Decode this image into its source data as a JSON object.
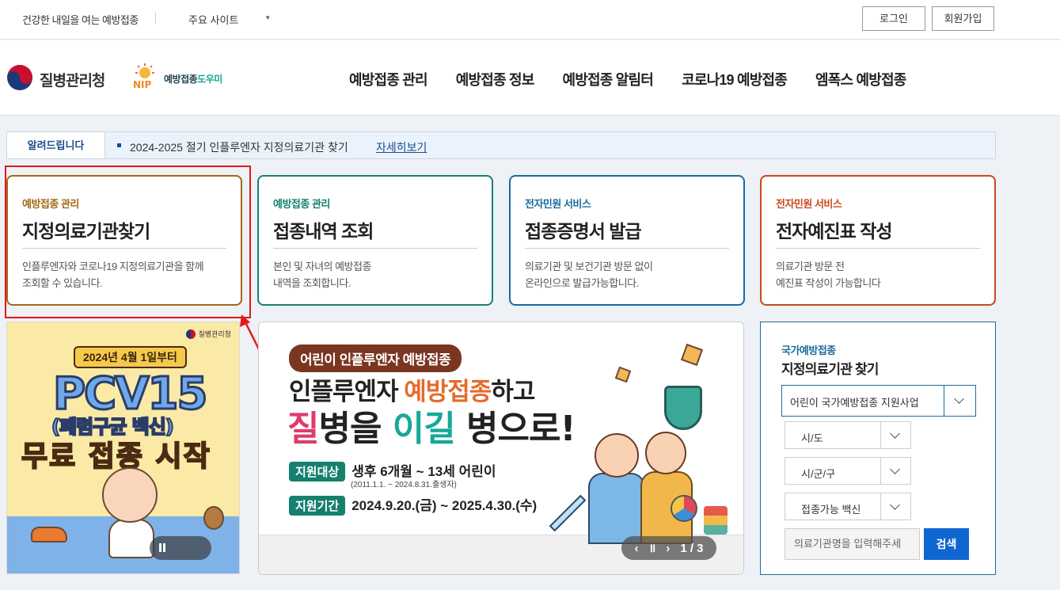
{
  "topbar": {
    "slogan": "건강한 내일을 여는 예방접종",
    "sites": "주요 사이트",
    "sites_caret": "▾",
    "login": "로그인",
    "join": "회원가입"
  },
  "header": {
    "kdca_name": "질병관리청",
    "nip_prefix": "예방접종",
    "nip_suffix": "도우미",
    "nip_badge": "NIP",
    "nav": [
      "예방접종 관리",
      "예방접종 정보",
      "예방접종 알림터",
      "코로나19 예방접종",
      "엠폭스 예방접종"
    ]
  },
  "notice": {
    "label": "알려드립니다",
    "text": "2024-2025 절기 인플루엔자 지정의료기관 찾기",
    "more": "자세히보기"
  },
  "cards": [
    {
      "category": "예방접종 관리",
      "title": "지정의료기관찾기",
      "desc1": "인플루엔자와 코로나19 지정의료기관을 함께",
      "desc2": "조회할 수 있습니다."
    },
    {
      "category": "예방접종 관리",
      "title": "접종내역 조회",
      "desc1": "본인 및 자녀의 예방접종",
      "desc2": "내역을 조회합니다."
    },
    {
      "category": "전자민원 서비스",
      "title": "접종증명서 발급",
      "desc1": "의료기관 및 보건기관 방문 없이",
      "desc2": "온라인으로 발급가능합니다."
    },
    {
      "category": "전자민원 서비스",
      "title": "전자예진표 작성",
      "desc1": "의료기관 방문 전",
      "desc2": "예진표 작성이 가능합니다"
    }
  ],
  "poster": {
    "logo": "질병관리청",
    "date": "2024년 4월 1일부터",
    "pcv": "PCV15",
    "sub": "(폐렴구균 백신)",
    "free": "무료 접종 시작"
  },
  "banner": {
    "tag": "어린이 인플루엔자 예방접종",
    "line1_a": "인플루엔자 ",
    "line1_b": "예방접종",
    "line1_c": "하고",
    "line2_a": "질",
    "line2_b": "병을 ",
    "line2_c": "이길",
    "line2_d": " 병으로!",
    "target_label": "지원대상",
    "target_value": "생후 6개월 ~ 13세 어린이",
    "target_note": "(2011.1.1. ~ 2024.8.31.출생자)",
    "period_label": "지원기간",
    "period_value": "2024.9.20.(금) ~ 2025.4.30.(수)",
    "prev": "‹",
    "pause": "॥",
    "next": "›",
    "page": "1 / 3"
  },
  "search": {
    "subtitle": "국가예방접종",
    "title": "지정의료기관 찾기",
    "program": "어린이 국가예방접종 지원사업",
    "sido": "시/도",
    "sigungu": "시/군/구",
    "vaccine": "접종가능 백신",
    "placeholder": "의료기관명을 입력해주세",
    "button": "검색"
  },
  "colors": {
    "card1": "#a26a12",
    "card2": "#148271",
    "card3": "#1a6c9f",
    "card4": "#c74a1e",
    "highlight_box": "#e01b1b",
    "search_button": "#1066d1"
  }
}
